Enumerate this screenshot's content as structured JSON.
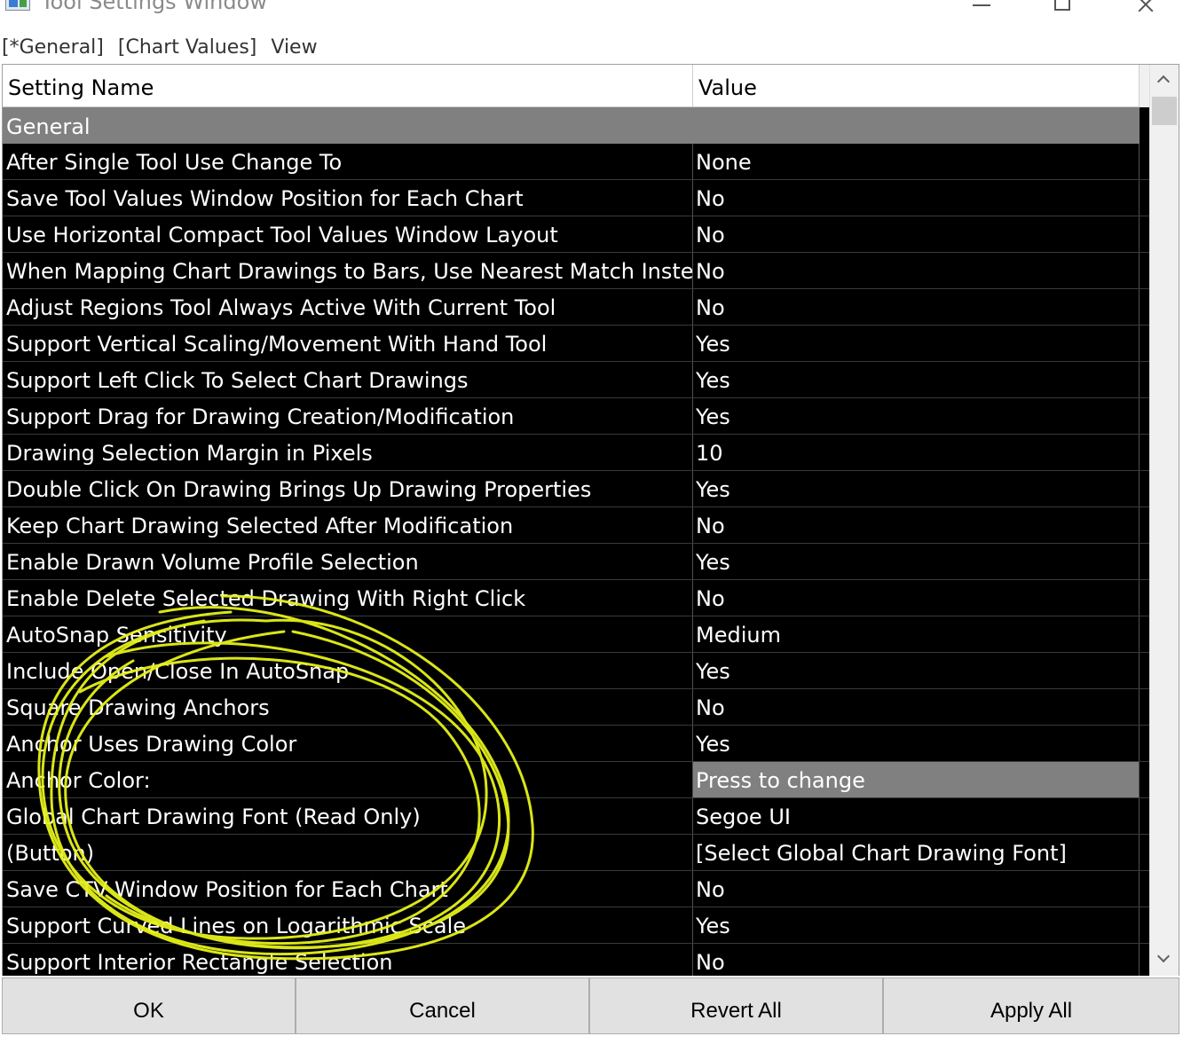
{
  "window": {
    "title": "Tool Settings Window",
    "icon": "app-chart-icon"
  },
  "menu": {
    "items": [
      "[*General]",
      "[Chart Values]",
      "View"
    ]
  },
  "grid": {
    "columns": [
      "Setting Name",
      "Value"
    ],
    "section": "General",
    "rows": [
      {
        "name": "After Single Tool Use Change To",
        "value": "None"
      },
      {
        "name": "Save Tool Values Window Position for Each Chart",
        "value": "No"
      },
      {
        "name": "Use Horizontal Compact Tool Values Window Layout",
        "value": "No"
      },
      {
        "name": "When Mapping Chart Drawings to Bars, Use Nearest Match Instea",
        "value": "No"
      },
      {
        "name": "Adjust Regions Tool Always Active With Current Tool",
        "value": "No"
      },
      {
        "name": "Support Vertical Scaling/Movement With Hand Tool",
        "value": "Yes"
      },
      {
        "name": "Support Left Click To Select Chart Drawings",
        "value": "Yes"
      },
      {
        "name": "Support Drag for Drawing Creation/Modification",
        "value": "Yes"
      },
      {
        "name": "Drawing Selection Margin in Pixels",
        "value": "10"
      },
      {
        "name": "Double Click On Drawing Brings Up Drawing Properties",
        "value": "Yes"
      },
      {
        "name": "Keep Chart Drawing Selected After Modification",
        "value": "No"
      },
      {
        "name": "Enable Drawn Volume Profile Selection",
        "value": "Yes"
      },
      {
        "name": "Enable Delete Selected Drawing With Right Click",
        "value": "No"
      },
      {
        "name": "AutoSnap Sensitivity",
        "value": "Medium"
      },
      {
        "name": "Include Open/Close In AutoSnap",
        "value": "Yes"
      },
      {
        "name": "Square Drawing Anchors",
        "value": "No"
      },
      {
        "name": "Anchor Uses Drawing Color",
        "value": "Yes"
      },
      {
        "name": "Anchor Color:",
        "value": "Press to change",
        "highlight": true
      },
      {
        "name": "Global Chart Drawing Font (Read Only)",
        "value": "Segoe UI"
      },
      {
        "name": "(Button)",
        "value": "[Select Global Chart Drawing Font]"
      },
      {
        "name": "Save CTV Window Position for Each Chart",
        "value": "No"
      },
      {
        "name": "Support Curved Lines on Logarithmic Scale",
        "value": "Yes"
      },
      {
        "name": "Support Interior Rectangle Selection",
        "value": "No"
      }
    ]
  },
  "buttons": {
    "ok": "OK",
    "cancel": "Cancel",
    "revert_all": "Revert All",
    "apply_all": "Apply All"
  },
  "colors": {
    "grid_background": "#000000",
    "section_background": "#808080",
    "highlight_cell": "#808080",
    "annotation": "#e6f21a"
  }
}
